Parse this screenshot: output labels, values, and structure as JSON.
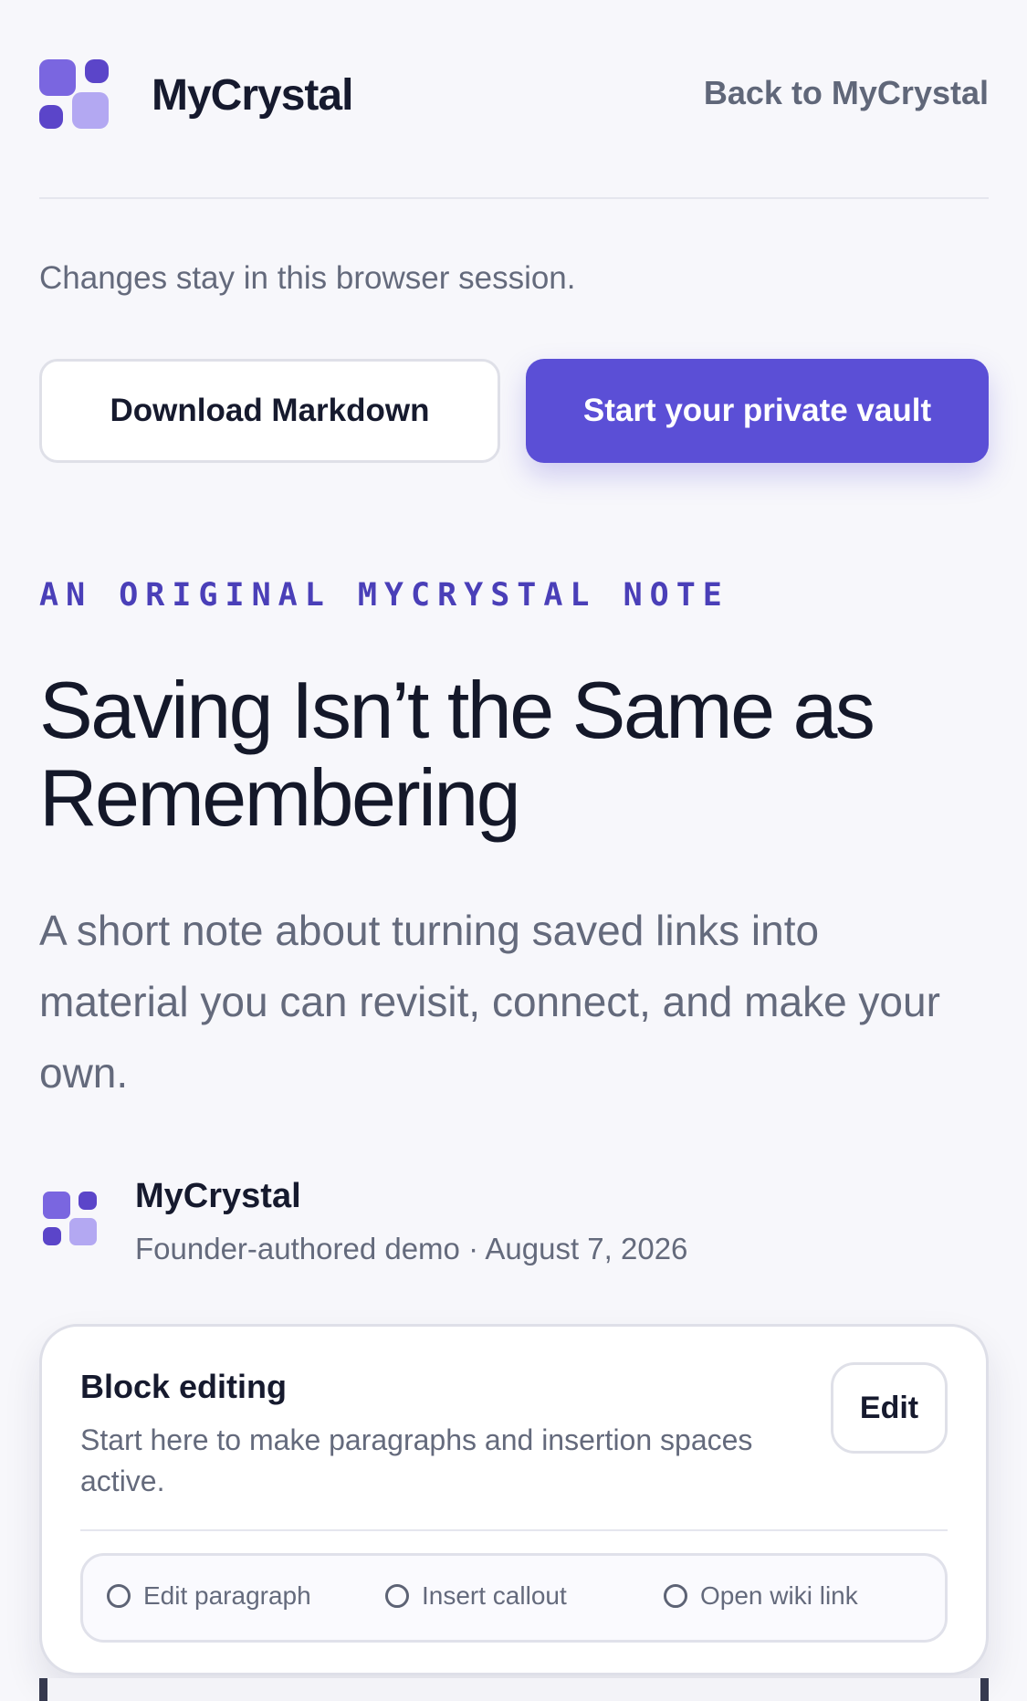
{
  "header": {
    "brand": "MyCrystal",
    "back_link": "Back to MyCrystal"
  },
  "session_note": "Changes stay in this browser session.",
  "actions_bar": {
    "download_label": "Download Markdown",
    "vault_label": "Start your private vault"
  },
  "article": {
    "eyebrow": "AN ORIGINAL MYCRYSTAL NOTE",
    "title": "Saving Isn’t the Same as Remembering",
    "lede": "A short note about turning saved links into material you can revisit, connect, and make your own."
  },
  "author": {
    "name": "MyCrystal",
    "meta": "Founder-authored demo · August 7, 2026"
  },
  "block_editing": {
    "title": "Block editing",
    "description": "Start here to make paragraphs and insertion spaces active.",
    "edit_label": "Edit",
    "options": [
      {
        "label": "Edit paragraph"
      },
      {
        "label": "Insert callout"
      },
      {
        "label": "Open wiki link"
      }
    ]
  },
  "colors": {
    "accent": "#5b4fd6",
    "logo_dark": "#5b45c9",
    "logo_mid": "#7a66e0",
    "logo_light": "#b3a8f2",
    "eyebrow": "#4a3fb8"
  }
}
